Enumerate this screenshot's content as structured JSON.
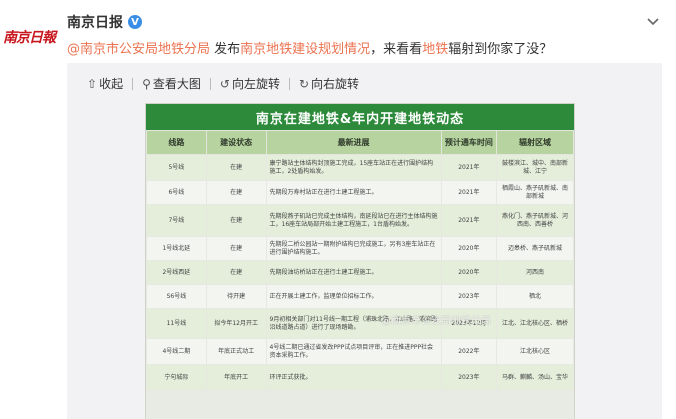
{
  "avatar": {
    "text": "南京日報"
  },
  "author": {
    "name": "南京日报",
    "verified_badge": "V"
  },
  "post": {
    "mention": "@南京市公安局地铁分局",
    "t1": " 发布",
    "link1": "南京地铁建设规划情况",
    "t2": "，来看看",
    "link2": "地铁",
    "t3": "辐射到你家了没？"
  },
  "toolbar": {
    "collapse": {
      "icon": "collapse-up-arrow-icon",
      "glyph": "⇧",
      "label": "收起"
    },
    "view_large": {
      "icon": "magnifier-icon",
      "glyph": "⚲",
      "label": "查看大图"
    },
    "rotate_left": {
      "icon": "rotate-left-icon",
      "glyph": "↺",
      "label": "向左旋转"
    },
    "rotate_right": {
      "icon": "rotate-right-icon",
      "glyph": "↻",
      "label": "向右旋转"
    }
  },
  "table": {
    "title": "南京在建地铁&年内开建地铁动态",
    "headers": [
      "线路",
      "建设状态",
      "最新进展",
      "预计通车时间",
      "辐射区域"
    ],
    "rows": [
      [
        "5号线",
        "在建",
        "康宁路站主体结构封顶施工完成，15座车站正在进行围护结构施工，2处盾构始发。",
        "2021年",
        "鼓楼滨江、城中、南部新城、江宁"
      ],
      [
        "6号线",
        "在建",
        "先期段万寿村站正在进行土建工程施工。",
        "2021年",
        "栖霞山、燕子矶新城、南部新城"
      ],
      [
        "7号线",
        "在建",
        "先期段燕子矶站已完成主体结构，南延段站已在进行主体结构施工，16座车站局部开始土建工程施工，1台盾构始发。",
        "2021年",
        "燕化门、燕子矶新城、河西南、西善桥"
      ],
      [
        "1号线北延",
        "在建",
        "先期段二桥公园站一期附护结构已完成施工，另有3座车站正在进行围护结构施工。",
        "2020年",
        "迈皋桥、燕子矶新城"
      ],
      [
        "2号线西延",
        "在建",
        "先期段油坊桥站正在进行土建工程施工。",
        "2020年",
        "河西南"
      ],
      [
        "S6号线",
        "待开建",
        "正在开展土建工作，监理单位招标工作。",
        "2023年",
        "栖北"
      ],
      [
        "11号线",
        "拟今年12月开工",
        "9月初相关部门对11号线一期工程（浦珠北路、江山路、浦滨路沿线道路占道）进行了现场踏勘。",
        "2023年12月",
        "江北、江北核心区、栖桥"
      ],
      [
        "4号线二期",
        "年底正式动工",
        "4号线二期已通过省发改PPP试点项目评审，正在推进PPP社会资本采购工作。",
        "2022年",
        "江北核心区"
      ],
      [
        "宁句城际",
        "年底开工",
        "环评正式获批。",
        "2023年",
        "马群、麒麟、汤山、宝华"
      ]
    ],
    "watermark": "@南京市公安局地铁分局"
  }
}
